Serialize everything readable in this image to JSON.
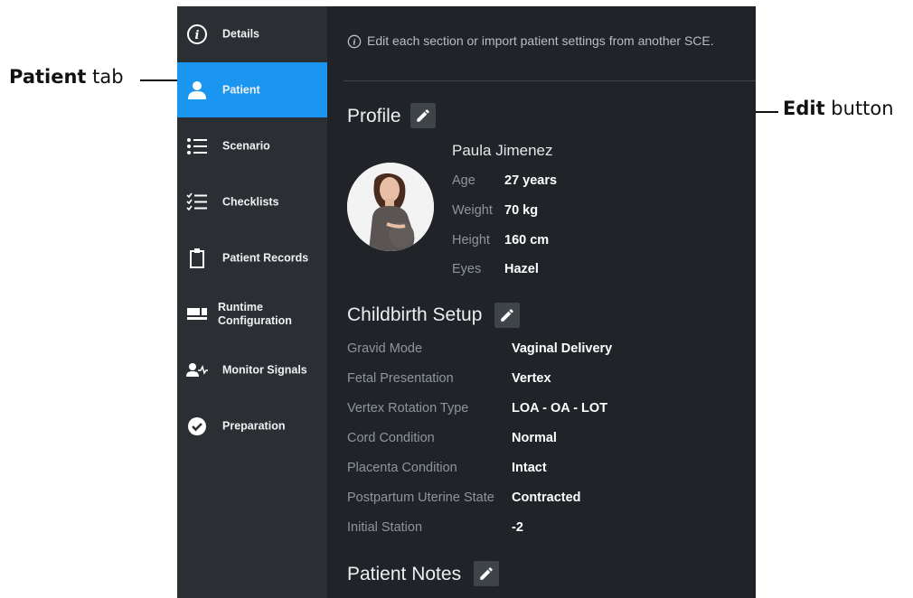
{
  "callouts": {
    "patient_tab": {
      "bold": "Patient",
      "rest": " tab"
    },
    "edit_button": {
      "bold": "Edit",
      "rest": " button"
    }
  },
  "sidebar": {
    "items": [
      {
        "label": "Details",
        "icon": "info-icon",
        "active": false
      },
      {
        "label": "Patient",
        "icon": "person-icon",
        "active": true
      },
      {
        "label": "Scenario",
        "icon": "list-icon",
        "active": false
      },
      {
        "label": "Checklists",
        "icon": "checklist-icon",
        "active": false
      },
      {
        "label": "Patient Records",
        "icon": "clipboard-icon",
        "active": false
      },
      {
        "label_line1": "Runtime",
        "label_line2": "Configuration",
        "icon": "layout-icon",
        "active": false
      },
      {
        "label": "Monitor Signals",
        "icon": "monitor-signals-icon",
        "active": false
      },
      {
        "label": "Preparation",
        "icon": "check-circle-icon",
        "active": false
      }
    ]
  },
  "main": {
    "info_text": "Edit each section or import patient settings from another SCE.",
    "profile": {
      "title": "Profile",
      "name": "Paula Jimenez",
      "fields": [
        {
          "label": "Age",
          "value": "27 years"
        },
        {
          "label": "Weight",
          "value": "70 kg"
        },
        {
          "label": "Height",
          "value": "160 cm"
        },
        {
          "label": "Eyes",
          "value": "Hazel"
        }
      ]
    },
    "childbirth": {
      "title": "Childbirth Setup",
      "fields": [
        {
          "label": "Gravid Mode",
          "value": "Vaginal Delivery"
        },
        {
          "label": "Fetal Presentation",
          "value": "Vertex"
        },
        {
          "label": "Vertex Rotation Type",
          "value": "LOA - OA - LOT"
        },
        {
          "label": "Cord Condition",
          "value": "Normal"
        },
        {
          "label": "Placenta Condition",
          "value": "Intact"
        },
        {
          "label": "Postpartum Uterine State",
          "value": "Contracted"
        },
        {
          "label": "Initial Station",
          "value": "-2"
        }
      ]
    },
    "notes": {
      "title": "Patient Notes"
    }
  },
  "colors": {
    "accent": "#1a96f0",
    "sidebar": "#2b2f33",
    "panel": "#202428"
  }
}
